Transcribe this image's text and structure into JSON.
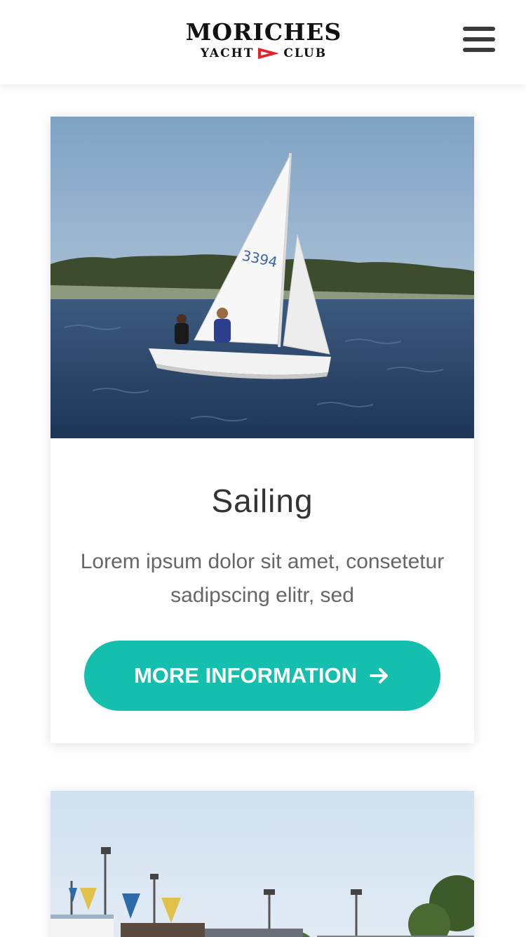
{
  "header": {
    "logo_main": "MORICHES",
    "logo_left": "YACHT",
    "logo_right": "CLUB",
    "logo_pennant_color": "#e8202a",
    "menu_icon": "hamburger-menu-icon"
  },
  "cards": [
    {
      "image": "sailboat-photo",
      "title": "Sailing",
      "text": "Lorem ipsum dolor sit amet, consetetur sadipscing elitr, sed",
      "button_label": "MORE INFORMATION",
      "button_icon": "arrow-right-icon",
      "sail_number": "3394"
    },
    {
      "image": "marina-flags-photo"
    }
  ],
  "colors": {
    "accent": "#15bfad",
    "title": "#333333",
    "body_text": "#666666"
  }
}
